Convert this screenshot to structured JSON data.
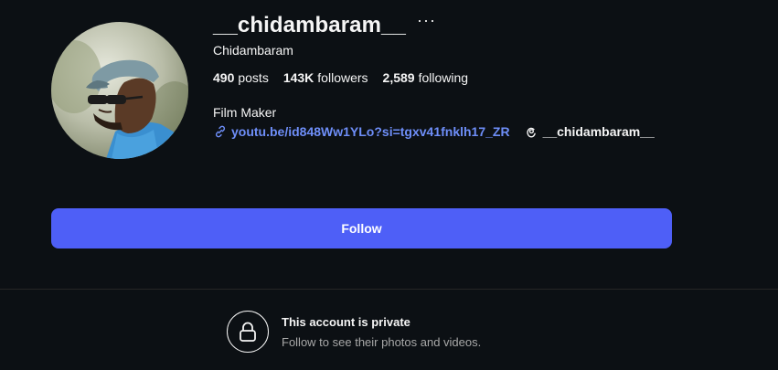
{
  "profile": {
    "username": "__chidambaram__",
    "more_label": "···",
    "full_name": "Chidambaram",
    "stats": {
      "posts_count": "490",
      "posts_label": "posts",
      "followers_count": "143K",
      "followers_label": "followers",
      "following_count": "2,589",
      "following_label": "following"
    },
    "bio": "Film Maker",
    "link_text": "youtu.be/id848Ww1YLo?si=tgxv41fnklh17_ZR",
    "threads_handle": "__chidambaram__"
  },
  "actions": {
    "follow_label": "Follow"
  },
  "private_notice": {
    "title": "This account is private",
    "subtitle": "Follow to see their photos and videos."
  },
  "colors": {
    "background": "#0c1014",
    "accent": "#4e5ff7",
    "link": "#6e8ef8",
    "secondary_text": "#a8a8a8"
  },
  "icons": {
    "more": "ellipsis-icon",
    "link": "link-icon",
    "threads": "threads-icon",
    "lock": "lock-icon"
  }
}
